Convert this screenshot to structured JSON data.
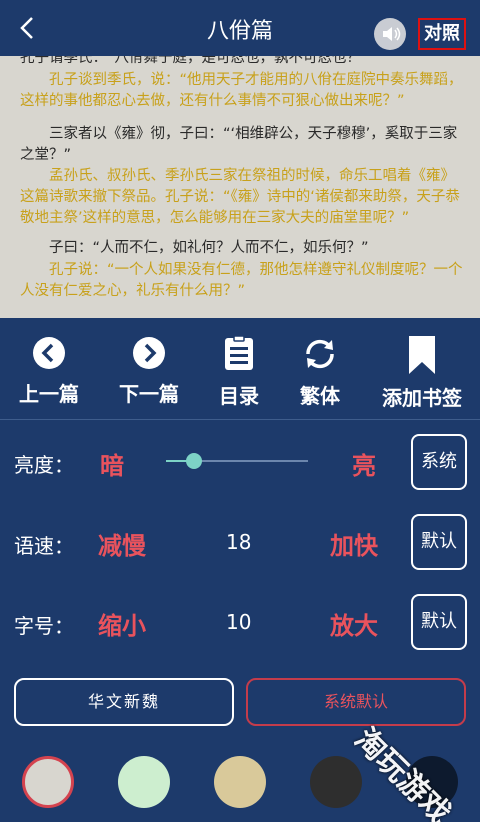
{
  "header": {
    "title": "八佾篇",
    "compare_label": "对照"
  },
  "reader": {
    "p0_top_partial": "孔子谓季氏：“八佾舞于庭，是可忍也，孰不可忍也？”",
    "p0_trans": "孔子谈到季氏，说：“他用天子才能用的八佾在庭院中奏乐舞蹈，这样的事他都忍心去做，还有什么事情不可狠心做出来呢？”",
    "p1_text": "三家者以《雍》彻，子曰：“‘相维辟公，天子穆穆’，奚取于三家之堂？”",
    "p1_trans": "孟孙氏、叔孙氏、季孙氏三家在祭祖的时候，命乐工唱着《雍》这篇诗歌来撤下祭品。孔子说：“《雍》诗中的‘诸侯都来助祭，天子恭敬地主祭’这样的意思，怎么能够用在三家大夫的庙堂里呢？”",
    "p2_text": "子曰：“人而不仁，如礼何？人而不仁，如乐何？”",
    "p2_trans": "孔子说：“一个人如果没有仁德，那他怎样遵守礼仪制度呢？一个人没有仁爱之心，礼乐有什么用？”"
  },
  "nav": {
    "prev": "上一篇",
    "next": "下一篇",
    "toc": "目录",
    "traditional": "繁体",
    "bookmark": "添加书签"
  },
  "settings": {
    "brightness": {
      "label": "亮度：",
      "dark": "暗",
      "bright": "亮",
      "button": "系统",
      "level": 0.2
    },
    "speed": {
      "label": "语速：",
      "slower": "减慢",
      "value": "18",
      "faster": "加快",
      "button": "默认"
    },
    "fontsize": {
      "label": "字号：",
      "smaller": "缩小",
      "value": "10",
      "larger": "放大",
      "button": "默认"
    }
  },
  "buttons": {
    "font": "华文新魏",
    "system_default": "系统默认"
  },
  "swatches": [
    "#d8d6cf",
    "#cdeecf",
    "#d9c99a",
    "#2e2e2e",
    "#0d1a2e"
  ],
  "watermark": "淘玩游戏"
}
